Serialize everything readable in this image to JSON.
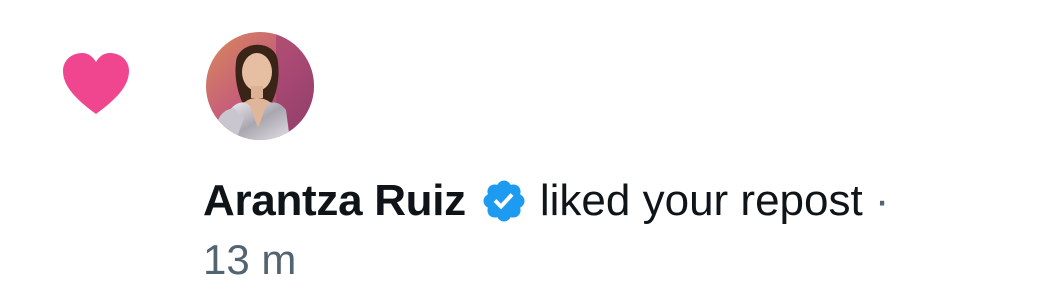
{
  "notification": {
    "type_icon": "heart-icon",
    "avatar_icon": "user-avatar",
    "user_name": "Arantza Ruiz",
    "verified_icon": "verified-badge-icon",
    "action_text": "liked your repost",
    "separator": "·",
    "timestamp": "13 m"
  },
  "colors": {
    "heart": "#f91880",
    "verified": "#1d9bf0",
    "text_primary": "#0f1419",
    "text_secondary": "#536471"
  }
}
